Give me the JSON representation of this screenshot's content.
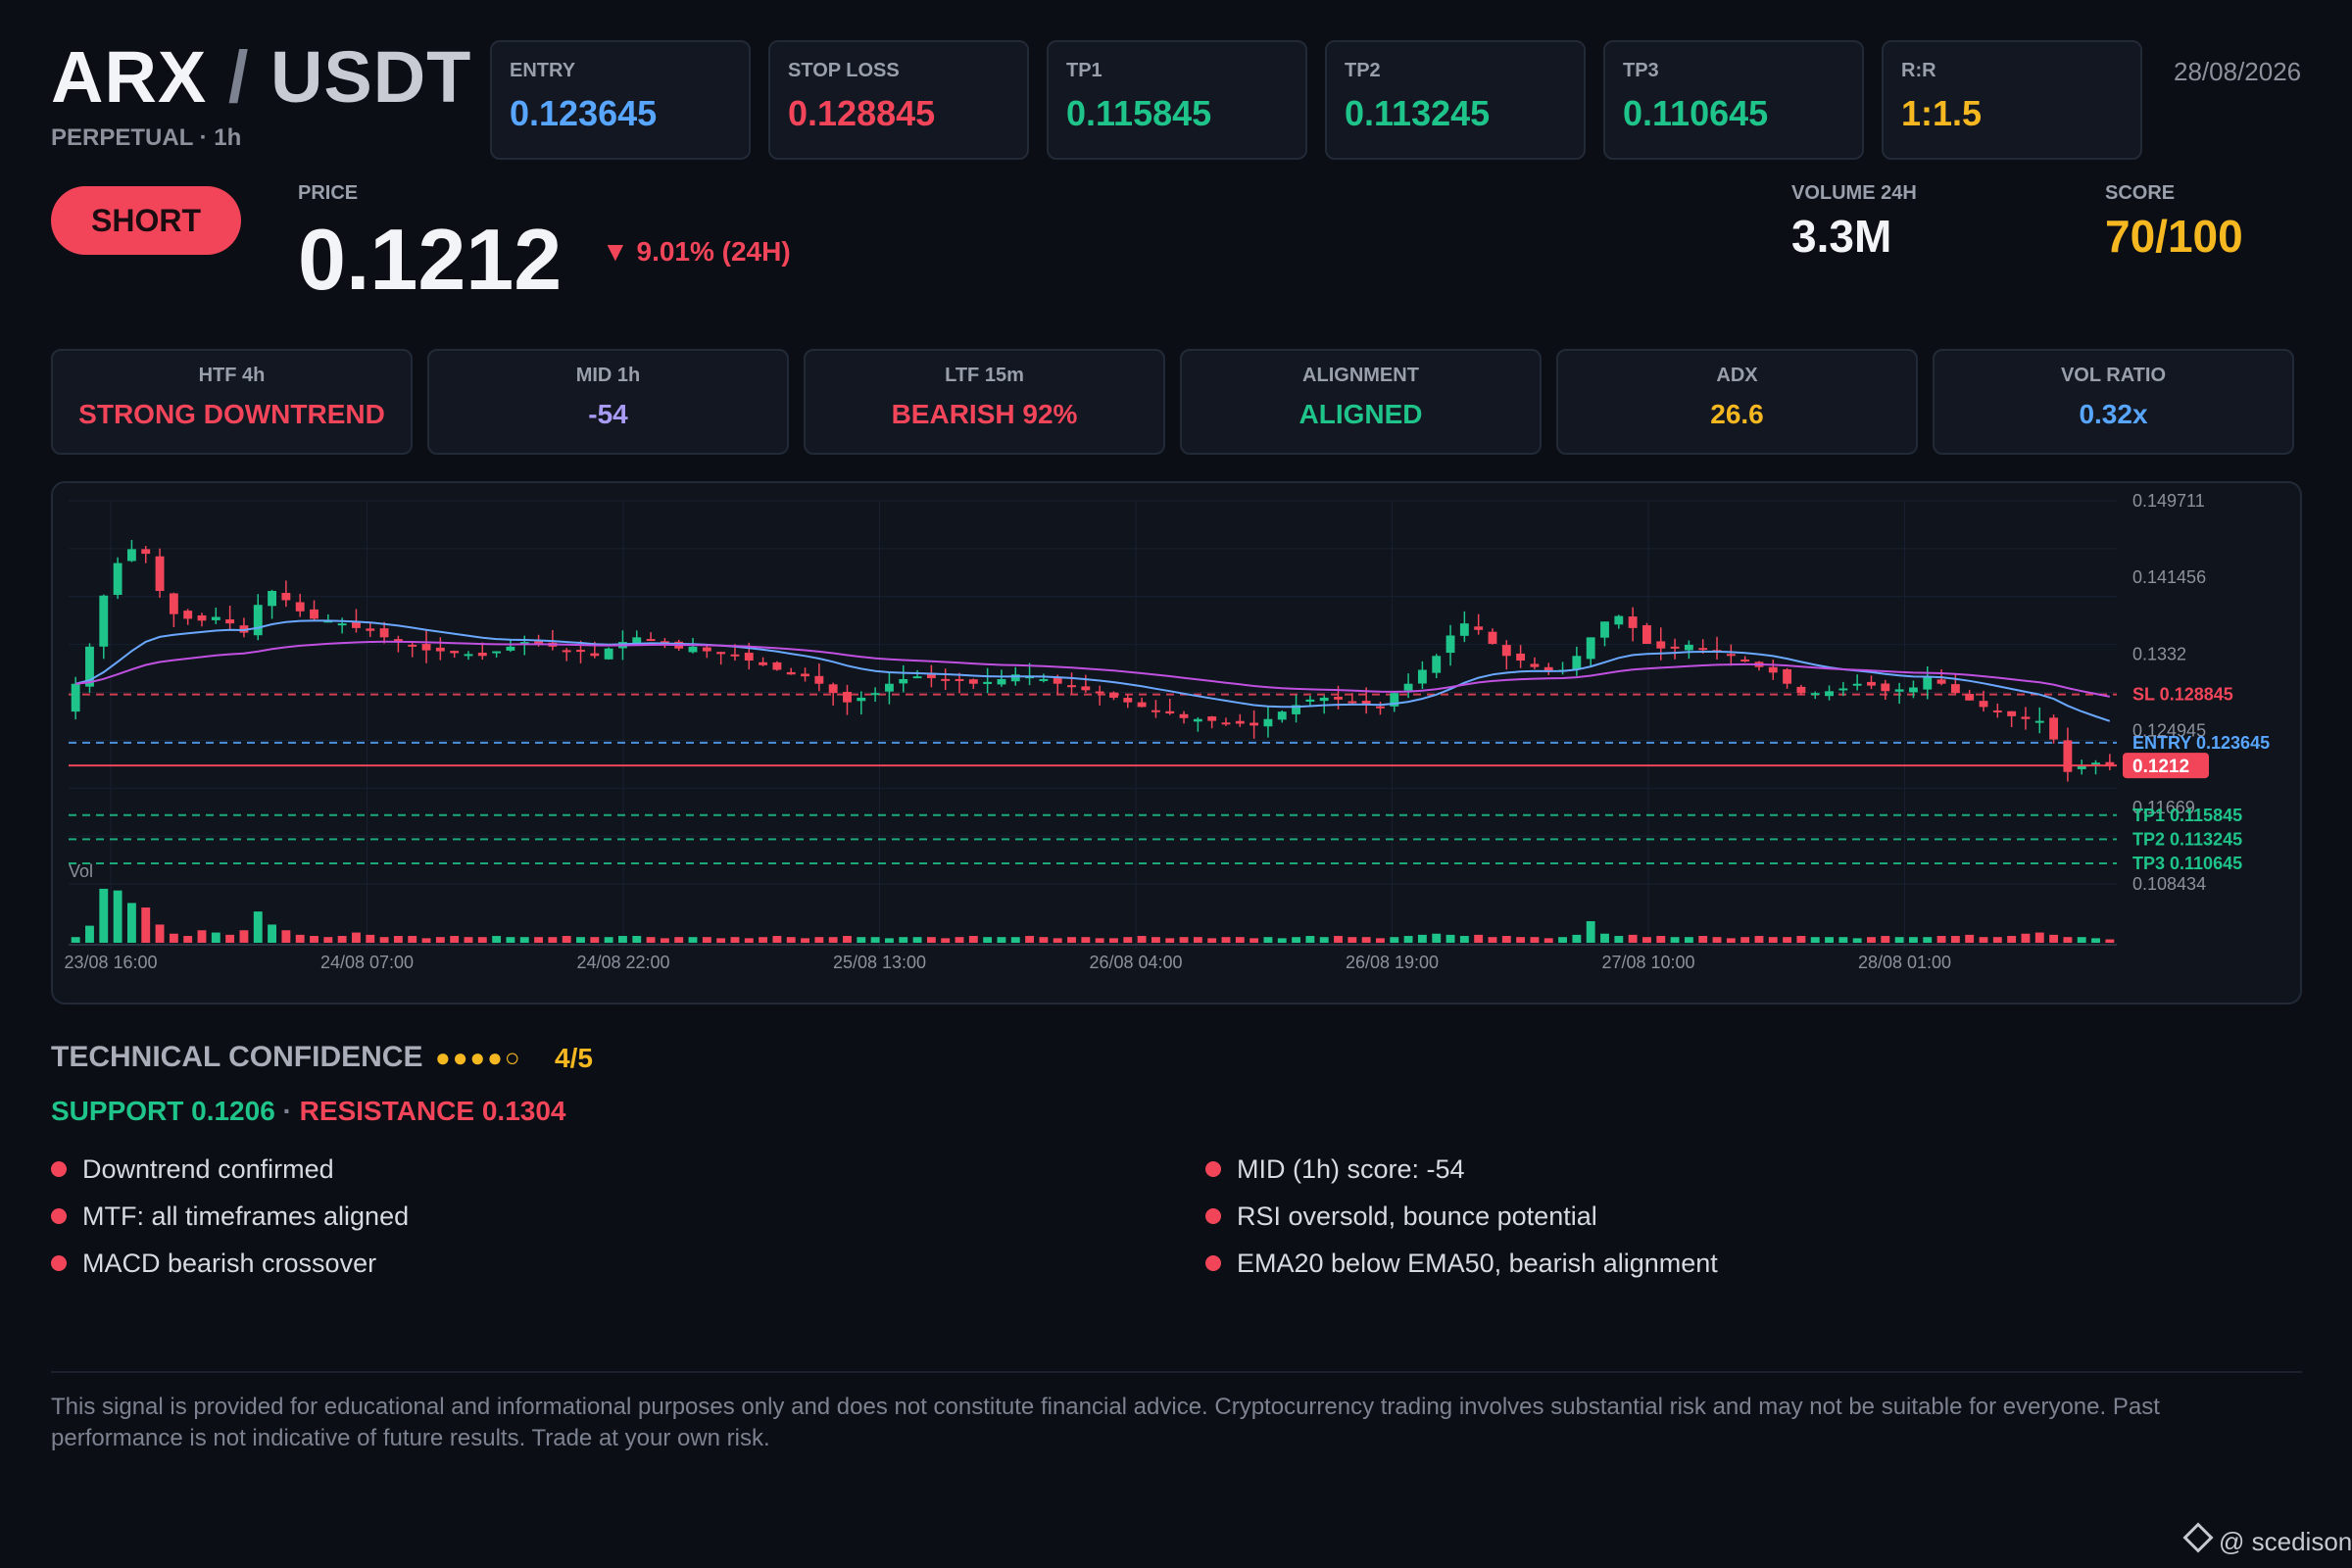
{
  "header": {
    "base": "ARX",
    "separator": "/",
    "quote": "USDT",
    "subtitle": "PERPETUAL · 1h",
    "date": "28/08/2026"
  },
  "levels": [
    {
      "label": "ENTRY",
      "value": "0.123645",
      "color": "#58a6ff"
    },
    {
      "label": "STOP LOSS",
      "value": "0.128845",
      "color": "#f3455a"
    },
    {
      "label": "TP1",
      "value": "0.115845",
      "color": "#1fc48a"
    },
    {
      "label": "TP2",
      "value": "0.113245",
      "color": "#1fc48a"
    },
    {
      "label": "TP3",
      "value": "0.110645",
      "color": "#1fc48a"
    },
    {
      "label": "R:R",
      "value": "1:1.5",
      "color": "#f5b820"
    }
  ],
  "signal": {
    "direction": "SHORT",
    "price_label": "PRICE",
    "price": "0.1212",
    "change": "▼ 9.01% (24H)",
    "volume_label": "VOLUME 24H",
    "volume": "3.3M",
    "score_label": "SCORE",
    "score": "70/100"
  },
  "metrics": [
    {
      "label": "HTF 4h",
      "value": "STRONG DOWNTREND",
      "color": "#f3455a"
    },
    {
      "label": "MID 1h",
      "value": "-54",
      "color": "#a99cf5"
    },
    {
      "label": "LTF 15m",
      "value": "BEARISH 92%",
      "color": "#f3455a"
    },
    {
      "label": "ALIGNMENT",
      "value": "ALIGNED",
      "color": "#1fc48a"
    },
    {
      "label": "ADX",
      "value": "26.6",
      "color": "#f5b820"
    },
    {
      "label": "VOL RATIO",
      "value": "0.32x",
      "color": "#58a6ff"
    }
  ],
  "chart_data": {
    "type": "candlestick",
    "x_ticks": [
      "23/08 16:00",
      "24/08 07:00",
      "24/08 22:00",
      "25/08 13:00",
      "26/08 04:00",
      "26/08 19:00",
      "27/08 10:00",
      "28/08 01:00"
    ],
    "y_ticks": [
      "0.149711",
      "0.141456",
      "0.1332",
      "0.124945",
      "0.11669",
      "0.108434"
    ],
    "ylim": [
      0.108434,
      0.149711
    ],
    "volume_label": "Vol",
    "current_price": "0.1212",
    "level_lines": [
      {
        "label": "SL 0.128845",
        "value": 0.128845,
        "color": "#f3455a"
      },
      {
        "label": "ENTRY 0.123645",
        "value": 0.123645,
        "color": "#58a6ff"
      },
      {
        "label": "TP1 0.115845",
        "value": 0.115845,
        "color": "#1fc48a"
      },
      {
        "label": "TP2 0.113245",
        "value": 0.113245,
        "color": "#1fc48a"
      },
      {
        "label": "TP3 0.110645",
        "value": 0.110645,
        "color": "#1fc48a"
      }
    ],
    "close_path": [
      0.13,
      0.134,
      0.1395,
      0.143,
      0.1445,
      0.144,
      0.14,
      0.1375,
      0.137,
      0.1368,
      0.1372,
      0.1365,
      0.1355,
      0.1385,
      0.14,
      0.139,
      0.1378,
      0.137,
      0.1368,
      0.1365,
      0.136,
      0.1357,
      0.135,
      0.1345,
      0.134,
      0.1336,
      0.1335,
      0.1333,
      0.1332,
      0.133,
      0.1335,
      0.134,
      0.1345,
      0.1342,
      0.134,
      0.1335,
      0.1335,
      0.133,
      0.1338,
      0.1345,
      0.135,
      0.1347,
      0.1343,
      0.1338,
      0.134,
      0.1335,
      0.1332,
      0.133,
      0.1325,
      0.132,
      0.1315,
      0.131,
      0.1308,
      0.13,
      0.129,
      0.128,
      0.1285,
      0.129,
      0.13,
      0.1305,
      0.1308,
      0.1306,
      0.1305,
      0.1303,
      0.13,
      0.1302,
      0.1305,
      0.131,
      0.1308,
      0.1305,
      0.13,
      0.1298,
      0.1293,
      0.129,
      0.1285,
      0.128,
      0.1275,
      0.127,
      0.1268,
      0.1263,
      0.1262,
      0.126,
      0.1258,
      0.1257,
      0.1255,
      0.1262,
      0.127,
      0.1277,
      0.1283,
      0.1285,
      0.1283,
      0.128,
      0.1277,
      0.1275,
      0.129,
      0.13,
      0.1315,
      0.133,
      0.1352,
      0.1365,
      0.1358,
      0.1343,
      0.133,
      0.1325,
      0.1318,
      0.1313,
      0.1315,
      0.133,
      0.135,
      0.1367,
      0.1373,
      0.136,
      0.1343,
      0.1338,
      0.134,
      0.1342,
      0.1338,
      0.1335,
      0.133,
      0.1325,
      0.1318,
      0.1312,
      0.13,
      0.129,
      0.129,
      0.1292,
      0.1295,
      0.13,
      0.1298,
      0.1292,
      0.1294,
      0.1296,
      0.1307,
      0.13,
      0.129,
      0.1282,
      0.1275,
      0.127,
      0.1265,
      0.1262,
      0.126,
      0.124,
      0.1205,
      0.1212,
      0.1215,
      0.1212
    ],
    "vol_path": [
      0.1,
      0.3,
      0.95,
      0.92,
      0.7,
      0.62,
      0.32,
      0.16,
      0.12,
      0.22,
      0.18,
      0.14,
      0.22,
      0.55,
      0.32,
      0.22,
      0.14,
      0.12,
      0.1,
      0.12,
      0.18,
      0.14,
      0.1,
      0.12,
      0.12,
      0.08,
      0.1,
      0.12,
      0.1,
      0.1,
      0.12,
      0.1,
      0.1,
      0.1,
      0.1,
      0.12,
      0.1,
      0.1,
      0.1,
      0.12,
      0.12,
      0.1,
      0.08,
      0.1,
      0.1,
      0.1,
      0.08,
      0.1,
      0.08,
      0.1,
      0.12,
      0.1,
      0.08,
      0.1,
      0.1,
      0.12,
      0.1,
      0.1,
      0.08,
      0.1,
      0.1,
      0.1,
      0.08,
      0.1,
      0.12,
      0.1,
      0.1,
      0.1,
      0.12,
      0.1,
      0.08,
      0.1,
      0.1,
      0.08,
      0.08,
      0.1,
      0.12,
      0.1,
      0.08,
      0.1,
      0.1,
      0.08,
      0.1,
      0.1,
      0.08,
      0.1,
      0.08,
      0.1,
      0.12,
      0.1,
      0.12,
      0.1,
      0.1,
      0.08,
      0.1,
      0.12,
      0.14,
      0.16,
      0.14,
      0.12,
      0.14,
      0.1,
      0.12,
      0.1,
      0.1,
      0.08,
      0.1,
      0.14,
      0.38,
      0.16,
      0.12,
      0.14,
      0.1,
      0.12,
      0.1,
      0.1,
      0.12,
      0.1,
      0.08,
      0.1,
      0.12,
      0.1,
      0.1,
      0.12,
      0.1,
      0.1,
      0.1,
      0.08,
      0.1,
      0.12,
      0.1,
      0.1,
      0.1,
      0.12,
      0.12,
      0.14,
      0.1,
      0.1,
      0.12,
      0.16,
      0.18,
      0.14,
      0.1,
      0.1,
      0.08,
      0.06
    ]
  },
  "confidence": {
    "title": "TECHNICAL CONFIDENCE",
    "dots": "●●●●○",
    "score": "4/5",
    "support": "SUPPORT 0.1206",
    "separator": " · ",
    "resistance": "RESISTANCE 0.1304"
  },
  "reasons_left": [
    "Downtrend confirmed",
    "MTF: all timeframes aligned",
    "MACD bearish crossover"
  ],
  "reasons_right": [
    "MID (1h) score: -54",
    "RSI oversold, bounce potential",
    "EMA20 below EMA50, bearish alignment"
  ],
  "disclaimer": "This signal is provided for educational and informational purposes only and does not constitute financial advice. Cryptocurrency trading involves substantial risk and may not be suitable for everyone. Past performance is not indicative of future results. Trade at your own risk.",
  "watermark": "@ scedison"
}
